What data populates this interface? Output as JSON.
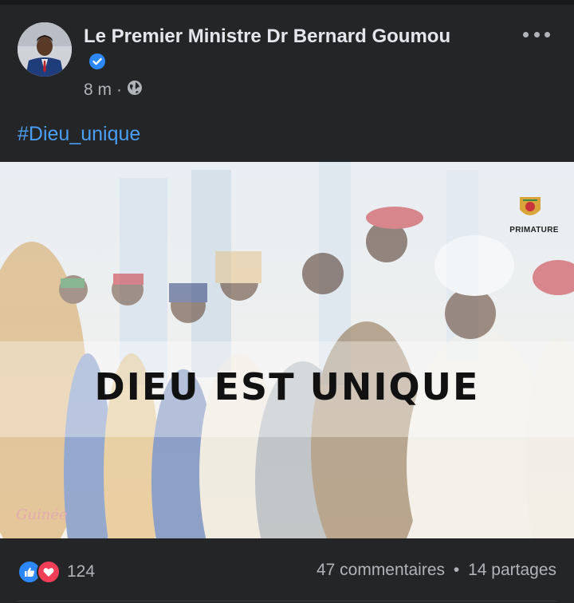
{
  "post": {
    "author": "Le Premier Ministre Dr Bernard Goumou",
    "time": "8 m",
    "separator": "·",
    "hashtag": "#Dieu_unique"
  },
  "media": {
    "overlay_text": "DIEU EST UNIQUE",
    "logo_label": "PRIMATURE",
    "watermark": "Guinée"
  },
  "footer": {
    "reaction_count": "124",
    "comments": "47 commentaires",
    "dot": "•",
    "shares": "14 partages"
  },
  "icons": {
    "verified": "verified-badge-icon",
    "privacy": "globe-icon",
    "more": "more-options-icon",
    "like": "like-reaction-icon",
    "love": "love-reaction-icon"
  },
  "colors": {
    "background": "#242526",
    "link": "#4b9ef5",
    "like": "#2d88ff",
    "love": "#f33e58"
  }
}
